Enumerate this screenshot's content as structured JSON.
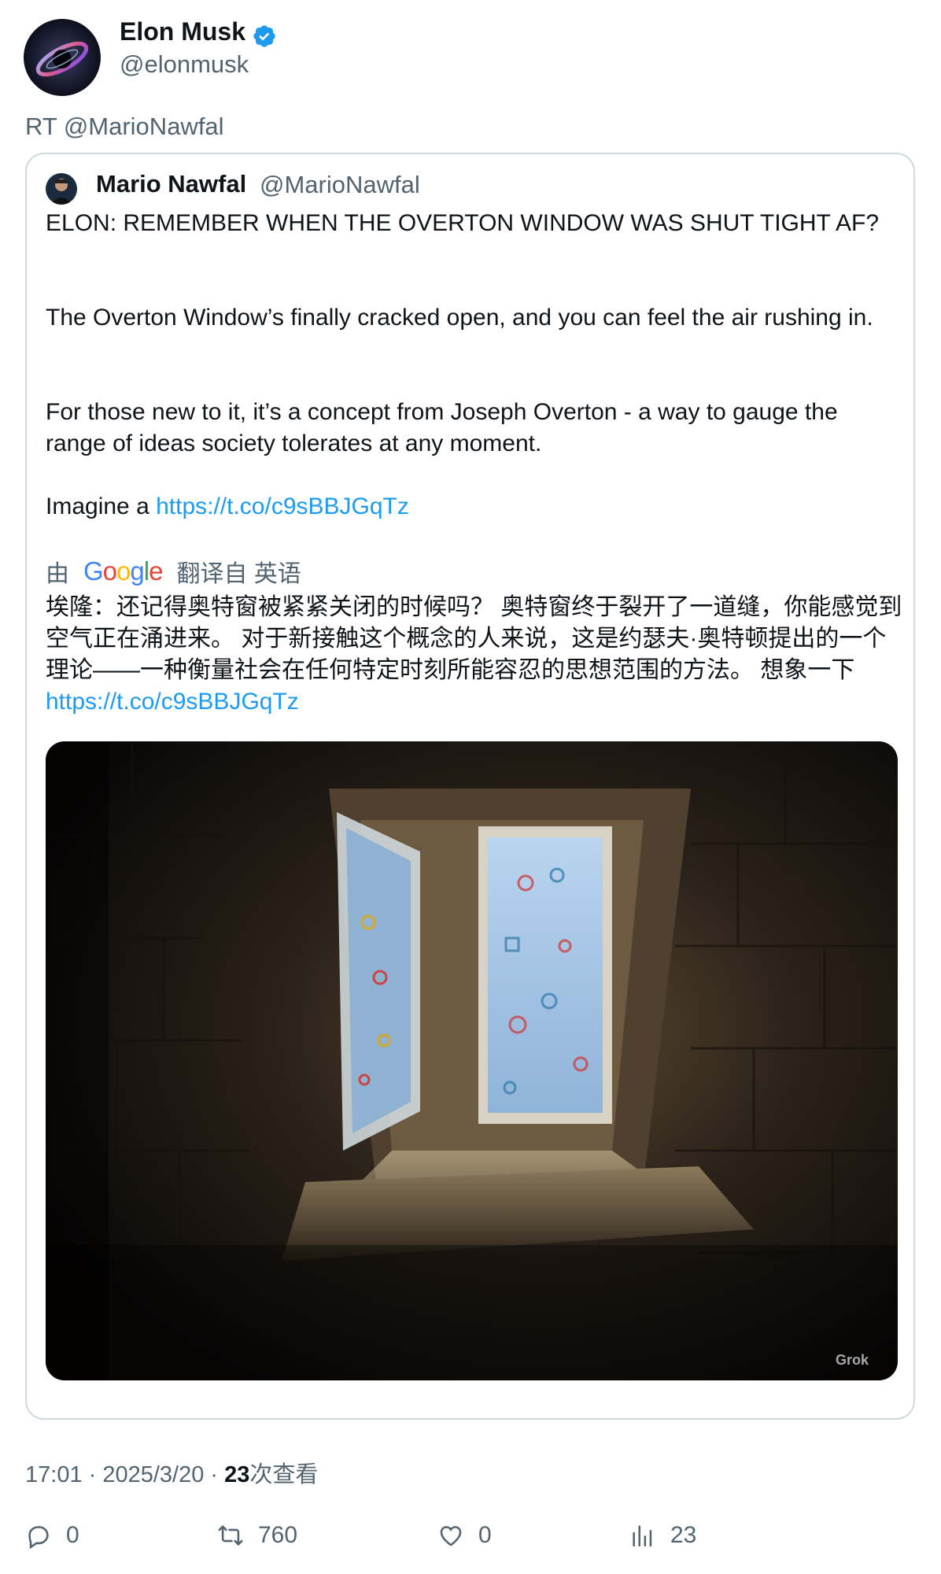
{
  "author": {
    "name": "Elon Musk",
    "handle": "@elonmusk",
    "verified_color": "#1d9bf0"
  },
  "retweet_label": "RT @MarioNawfal",
  "quoted": {
    "name": "Mario Nawfal",
    "handle": "@MarioNawfal",
    "paragraphs": [
      "ELON: REMEMBER WHEN THE OVERTON WINDOW WAS SHUT TIGHT AF?",
      "The Overton Window’s finally cracked open, and you can feel the air rushing in.",
      "For those new to it, it’s a concept from Joseph Overton - a way to gauge the range of ideas society tolerates at any moment."
    ],
    "imagine_prefix": "Imagine a ",
    "link": "https://t.co/c9sBBJGqTz",
    "translate_by": "由",
    "translate_from": "翻译自 英语",
    "translated_text": "埃隆：还记得奥特窗被紧紧关闭的时候吗？ 奥特窗终于裂开了一道缝，你能感觉到空气正在涌进来。 对于新接触这个概念的人来说，这是约瑟夫·奥特顿提出的一个理论——一种衡量社会在任何特定时刻所能容忍的思想范围的方法。 想象一下 ",
    "translated_link": "https://t.co/c9sBBJGqTz",
    "media_badge": "Grok"
  },
  "meta": {
    "time": "17:01",
    "date": "2025/3/20",
    "views_count": "23",
    "views_label": "次查看"
  },
  "actions": {
    "replies": "0",
    "retweets": "760",
    "likes": "0",
    "views": "23"
  }
}
